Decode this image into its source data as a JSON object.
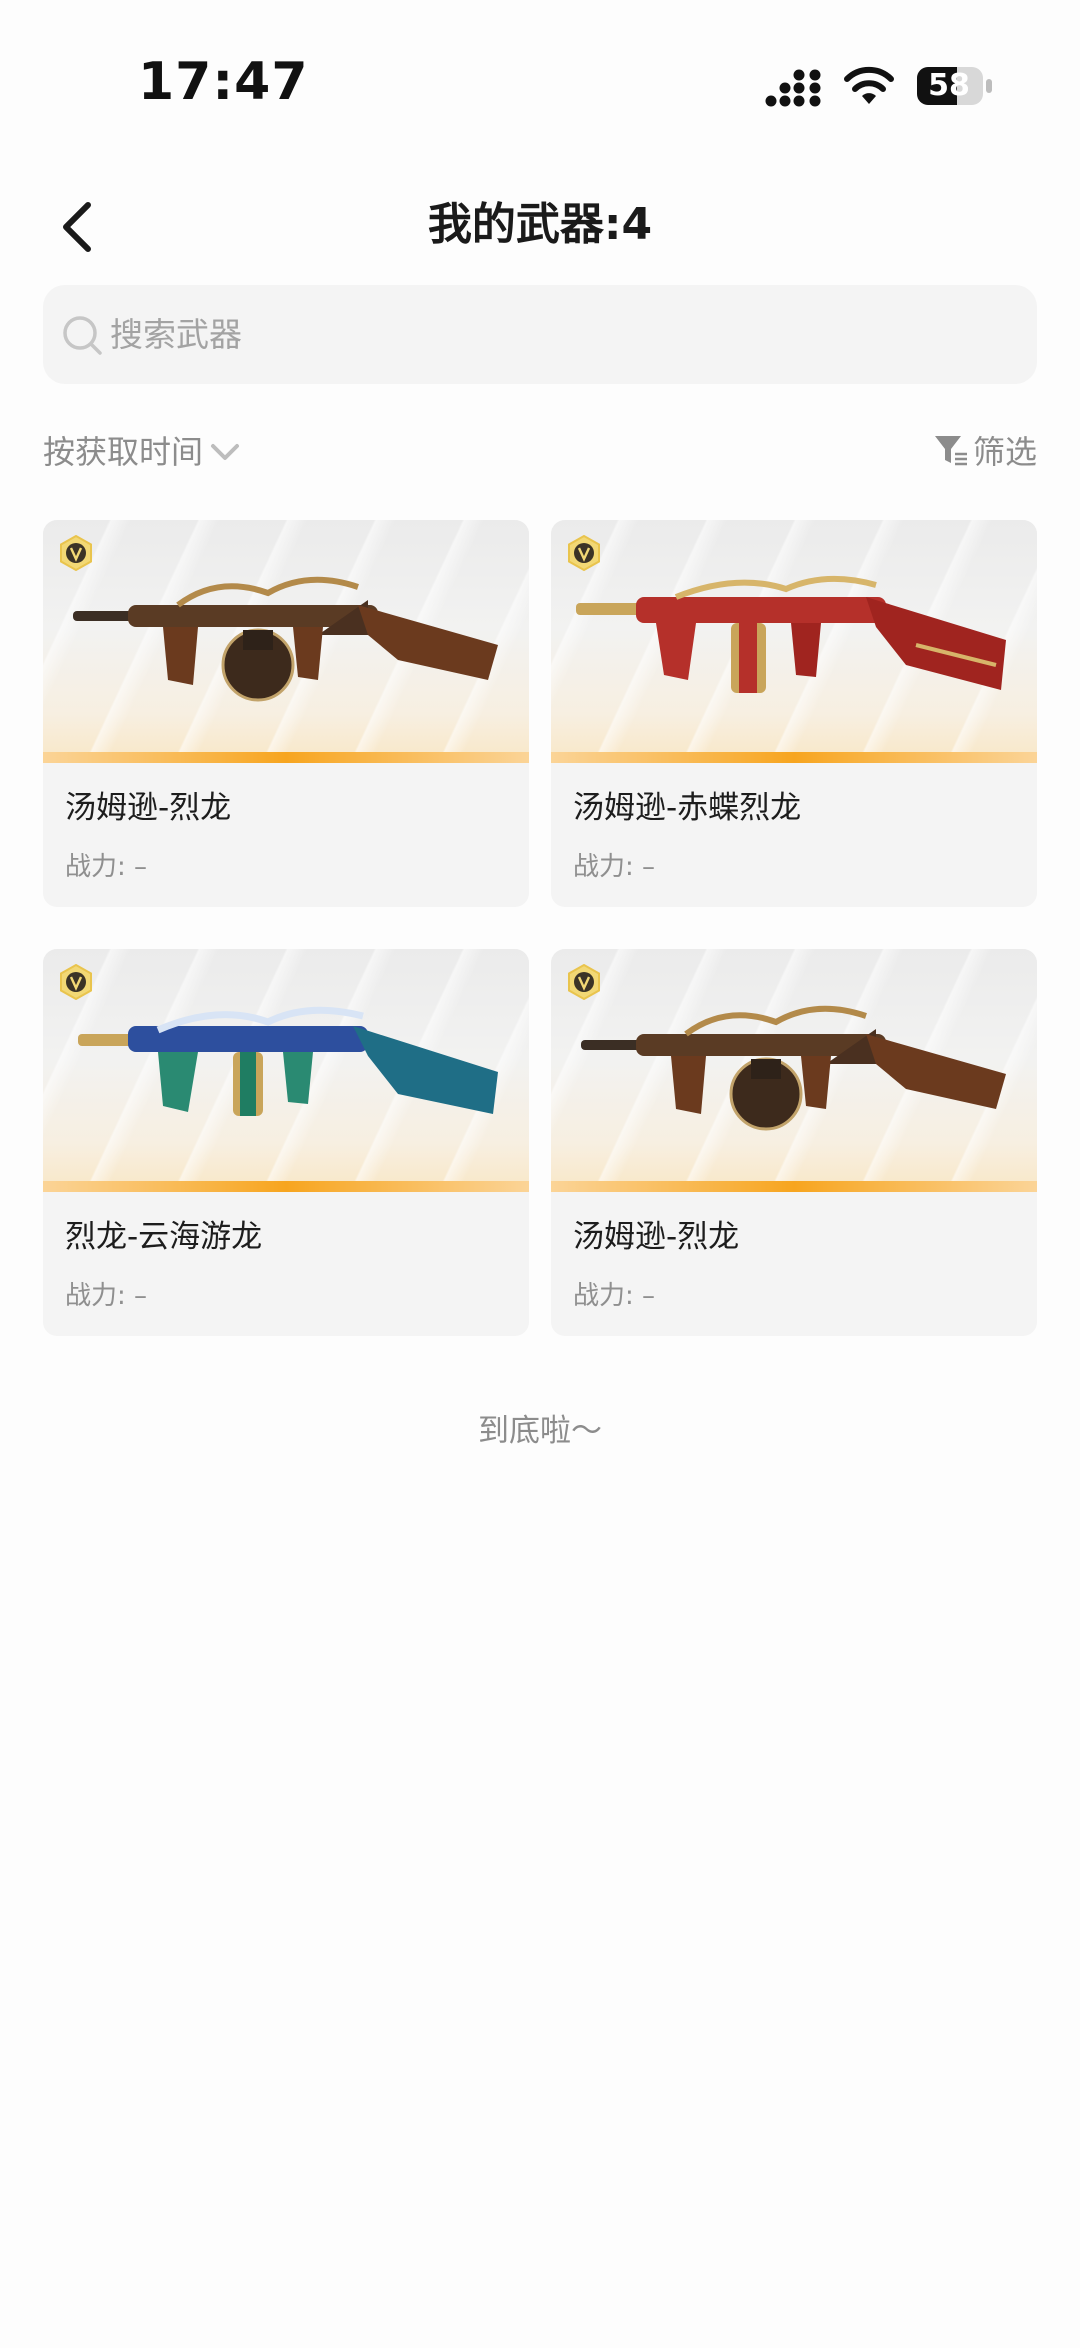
{
  "status": {
    "time": "17:47",
    "battery": "58"
  },
  "header": {
    "title": "我的武器:4"
  },
  "search": {
    "placeholder": "搜索武器"
  },
  "filters": {
    "sort_label": "按获取时间",
    "filter_label": "筛选"
  },
  "weapons": [
    {
      "name": "汤姆逊-烈龙",
      "power_label": "战力:",
      "power_value": "–",
      "palette": "bronze-dragon"
    },
    {
      "name": "汤姆逊-赤蝶烈龙",
      "power_label": "战力:",
      "power_value": "–",
      "palette": "red-gold"
    },
    {
      "name": "烈龙-云海游龙",
      "power_label": "战力:",
      "power_value": "–",
      "palette": "blue-green"
    },
    {
      "name": "汤姆逊-烈龙",
      "power_label": "战力:",
      "power_value": "–",
      "palette": "bronze-dragon"
    }
  ],
  "footer": {
    "end_text": "到底啦～"
  },
  "colors": {
    "accent": "#f7a51f",
    "badge": "#e9c44d",
    "text_muted": "#8c8c8c"
  }
}
